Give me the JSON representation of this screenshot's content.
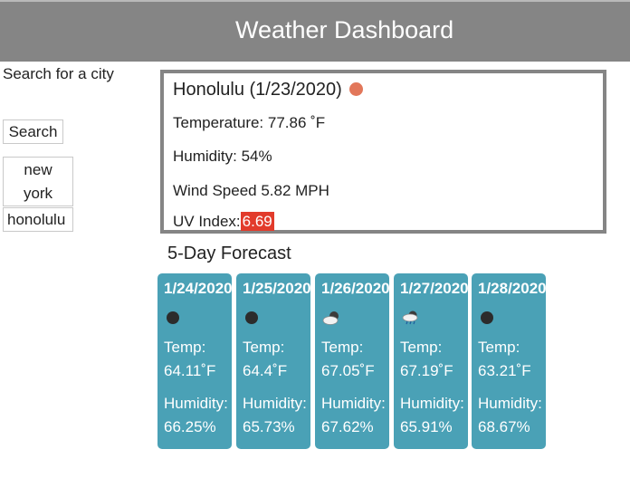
{
  "header": {
    "title": "Weather Dashboard"
  },
  "sidebar": {
    "search_label": "Search for a city",
    "search_button": "Search",
    "history": [
      "new york",
      "honolulu"
    ]
  },
  "current": {
    "city_title": "Honolulu (1/23/2020)",
    "icon": "sun-icon",
    "temperature": "Temperature: 77.86 ˚F",
    "humidity": "Humidity: 54%",
    "wind": "Wind Speed 5.82 MPH",
    "uv_label": "UV Index:",
    "uv_value": "6.69",
    "uv_color": "#e23b2b"
  },
  "forecast": {
    "title": "5-Day Forecast",
    "days": [
      {
        "date": "1/24/2020",
        "icon": "clear-night-icon",
        "temp_label": "Temp:",
        "temp": "64.11˚F",
        "humidity_label": "Humidity:",
        "humidity": "66.25%"
      },
      {
        "date": "1/25/2020",
        "icon": "clear-night-icon",
        "temp_label": "Temp:",
        "temp": "64.4˚F",
        "humidity_label": "Humidity:",
        "humidity": "65.73%"
      },
      {
        "date": "1/26/2020",
        "icon": "partly-cloudy-icon",
        "temp_label": "Temp:",
        "temp": "67.05˚F",
        "humidity_label": "Humidity:",
        "humidity": "67.62%"
      },
      {
        "date": "1/27/2020",
        "icon": "rain-cloud-icon",
        "temp_label": "Temp:",
        "temp": "67.19˚F",
        "humidity_label": "Humidity:",
        "humidity": "65.91%"
      },
      {
        "date": "1/28/2020",
        "icon": "clear-night-icon",
        "temp_label": "Temp:",
        "temp": "63.21˚F",
        "humidity_label": "Humidity:",
        "humidity": "68.67%"
      }
    ]
  },
  "colors": {
    "header_bg": "#858585",
    "card_bg": "#4aa1b6",
    "sun_icon": "#e2775a"
  }
}
